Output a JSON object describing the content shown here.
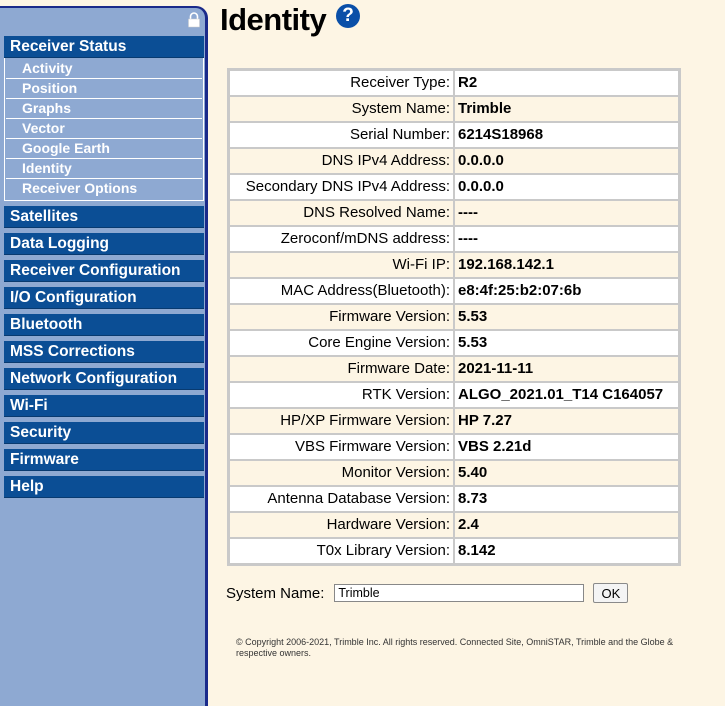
{
  "page": {
    "title": "Identity"
  },
  "sidebar": {
    "active_section": "Receiver Status",
    "active_items": [
      "Activity",
      "Position",
      "Graphs",
      "Vector",
      "Google Earth",
      "Identity",
      "Receiver Options"
    ],
    "sections": [
      "Satellites",
      "Data Logging",
      "Receiver Configuration",
      "I/O Configuration",
      "Bluetooth",
      "MSS Corrections",
      "Network Configuration",
      "Wi-Fi",
      "Security",
      "Firmware",
      "Help"
    ]
  },
  "identity_rows": [
    {
      "label": "Receiver Type:",
      "value": "R2"
    },
    {
      "label": "System Name:",
      "value": "Trimble"
    },
    {
      "label": "Serial Number:",
      "value": "6214S18968"
    },
    {
      "label": "DNS IPv4 Address:",
      "value": "0.0.0.0"
    },
    {
      "label": "Secondary DNS IPv4 Address:",
      "value": "0.0.0.0"
    },
    {
      "label": "DNS Resolved Name:",
      "value": "----"
    },
    {
      "label": "Zeroconf/mDNS address:",
      "value": "----"
    },
    {
      "label": "Wi-Fi IP:",
      "value": "192.168.142.1"
    },
    {
      "label": "MAC Address(Bluetooth):",
      "value": "e8:4f:25:b2:07:6b"
    },
    {
      "label": "Firmware Version:",
      "value": "5.53"
    },
    {
      "label": "Core Engine Version:",
      "value": "5.53"
    },
    {
      "label": "Firmware Date:",
      "value": "2021-11-11"
    },
    {
      "label": "RTK Version:",
      "value": "ALGO_2021.01_T14 C164057"
    },
    {
      "label": "HP/XP Firmware Version:",
      "value": "HP 7.27"
    },
    {
      "label": "VBS Firmware Version:",
      "value": "VBS 2.21d"
    },
    {
      "label": "Monitor Version:",
      "value": "5.40"
    },
    {
      "label": "Antenna Database Version:",
      "value": "8.73"
    },
    {
      "label": "Hardware Version:",
      "value": "2.4"
    },
    {
      "label": "T0x Library Version:",
      "value": "8.142"
    }
  ],
  "form": {
    "label": "System Name:",
    "value": "Trimble",
    "ok_label": "OK"
  },
  "footer": {
    "line1": "© Copyright 2006-2021, Trimble Inc. All rights reserved. Connected Site, OmniSTAR, Trimble and the Globe &",
    "line2": "respective owners."
  },
  "help": {
    "glyph": "?"
  },
  "colors": {
    "sidebar_bg": "#8ea9d2",
    "nav_header_bg": "#0b4e95",
    "page_bg": "#fdf5e4",
    "help_icon": "#0a4fa8"
  }
}
